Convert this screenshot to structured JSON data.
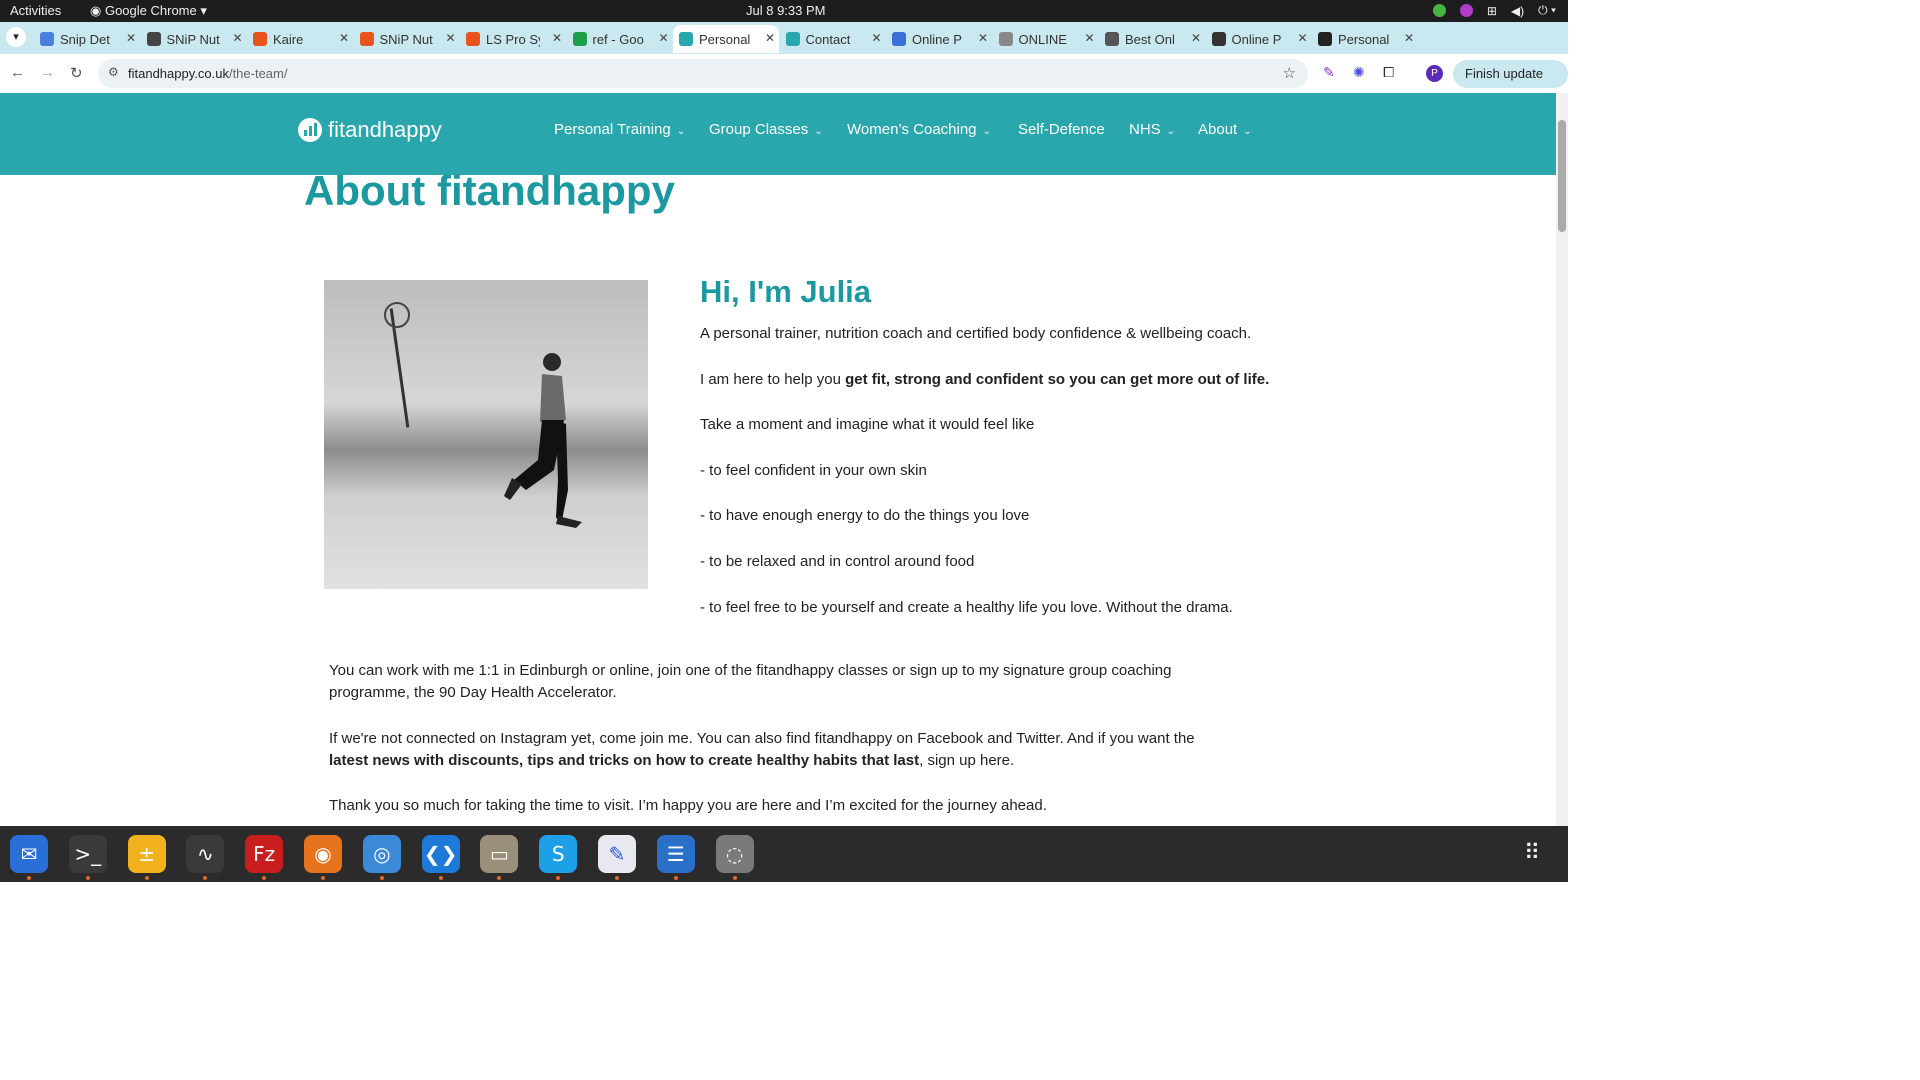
{
  "system_bar": {
    "activities": "Activities",
    "app_name": "Google Chrome",
    "clock": "Jul 8  9:33 PM"
  },
  "tabs": [
    {
      "title": "Snip Det",
      "favicon_color": "#4a7fe0",
      "active": false
    },
    {
      "title": "SNiP Nut",
      "favicon_color": "#444444",
      "active": false
    },
    {
      "title": "Kaire",
      "favicon_color": "#e8531e",
      "active": false
    },
    {
      "title": "SNiP Nut",
      "favicon_color": "#e8531e",
      "active": false
    },
    {
      "title": "LS Pro Sy",
      "favicon_color": "#e8531e",
      "active": false
    },
    {
      "title": "ref - Goo",
      "favicon_color": "#1e9e4a",
      "active": false
    },
    {
      "title": "Personal",
      "favicon_color": "#2aa7ad",
      "active": true
    },
    {
      "title": "Contact",
      "favicon_color": "#2aa7ad",
      "active": false
    },
    {
      "title": "Online P",
      "favicon_color": "#3a6fd8",
      "active": false
    },
    {
      "title": "ONLINE",
      "favicon_color": "#888888",
      "active": false
    },
    {
      "title": "Best Onl",
      "favicon_color": "#555555",
      "active": false
    },
    {
      "title": "Online P",
      "favicon_color": "#333333",
      "active": false
    },
    {
      "title": "Personal",
      "favicon_color": "#222222",
      "active": false
    }
  ],
  "address_bar": {
    "domain": "fitandhappy.co.uk",
    "path": "/the-team/",
    "finish_update": "Finish update",
    "profile_initial": "P"
  },
  "site": {
    "brand": "fitandhappy",
    "accent_color": "#2aa7ad",
    "nav": [
      {
        "label": "Personal Training",
        "has_dropdown": true
      },
      {
        "label": "Group Classes",
        "has_dropdown": true
      },
      {
        "label": "Women’s Coaching",
        "has_dropdown": true
      },
      {
        "label": "Self-Defence",
        "has_dropdown": false
      },
      {
        "label": "NHS",
        "has_dropdown": true
      },
      {
        "label": "About",
        "has_dropdown": true
      }
    ]
  },
  "content": {
    "title": "About fitandhappy",
    "greeting": "Hi, I'm Julia",
    "intro": "A personal trainer, nutrition coach and certified body confidence & wellbeing coach.",
    "help_prefix": "I am here to help you ",
    "help_bold": "get fit, strong and confident so you can get more out of life.",
    "imagine": "Take a moment and imagine what it would feel like",
    "bullets": [
      "- to feel confident in your own skin",
      "- to have enough energy to do the things you love",
      "- to be relaxed and in control around food",
      "- to feel free to be yourself and create a healthy life you love. Without the drama."
    ],
    "work_with_me": "You can work with me 1:1 in Edinburgh or online, join one of the fitandhappy classes or sign up to my signature group coaching programme, the 90 Day Health Accelerator.",
    "connect_prefix": "If we're not connected on Instagram yet, come join me. You can also find fitandhappy on Facebook and Twitter. And if you want the ",
    "connect_bold": "latest news with discounts, tips and tricks on how to create healthy habits that last",
    "connect_suffix": ", sign up here.",
    "thanks": "Thank you so much for taking the time to visit. I’m happy you are here and I’m excited for the journey ahead."
  },
  "dock": [
    {
      "name": "thunderbird",
      "color": "#2a6fd8",
      "glyph": "✉"
    },
    {
      "name": "terminal",
      "color": "#3a3a3a",
      "glyph": ">_"
    },
    {
      "name": "calculator",
      "color": "#f2b21e",
      "glyph": "±"
    },
    {
      "name": "system-monitor",
      "color": "#3a3a3a",
      "glyph": "∿"
    },
    {
      "name": "filezilla",
      "color": "#c81e1e",
      "glyph": "Fz"
    },
    {
      "name": "firefox",
      "color": "#e8731e",
      "glyph": "◉"
    },
    {
      "name": "chrome",
      "color": "#3a8ad8",
      "glyph": "◎"
    },
    {
      "name": "vscode",
      "color": "#1e7ad8",
      "glyph": "❮❯"
    },
    {
      "name": "files",
      "color": "#9a8f7a",
      "glyph": "▭"
    },
    {
      "name": "skype",
      "color": "#1ea0e8",
      "glyph": "S"
    },
    {
      "name": "text-editor",
      "color": "#e8e8f0",
      "glyph": "✎"
    },
    {
      "name": "writer",
      "color": "#2a70c8",
      "glyph": "☰"
    },
    {
      "name": "disks",
      "color": "#7a7a7a",
      "glyph": "◌"
    }
  ]
}
